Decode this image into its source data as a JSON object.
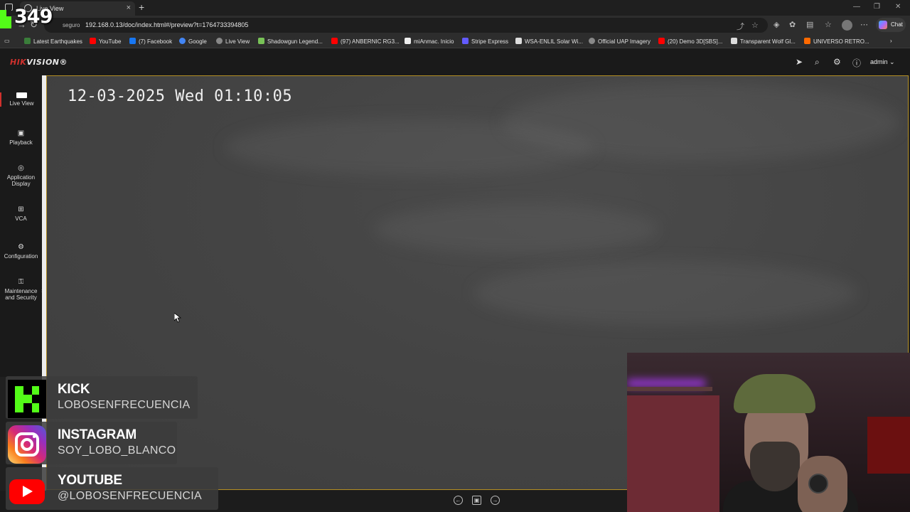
{
  "browser": {
    "tab_title": "Live View",
    "url_prefix": "seguro",
    "url": "192.168.0.13/doc/index.html#/preview?t=1764733394805",
    "chat_label": "Chat",
    "bookmarks": [
      {
        "label": "Latest Earthquakes",
        "color": "#3a7d3a"
      },
      {
        "label": "YouTube",
        "color": "#ff0000"
      },
      {
        "label": "(7) Facebook",
        "color": "#1877f2"
      },
      {
        "label": "Google",
        "color": "#4285f4"
      },
      {
        "label": "Live View",
        "color": "#888888"
      },
      {
        "label": "Shadowgun Legend...",
        "color": "#78c257"
      },
      {
        "label": "(97) ANBERNIC RG3...",
        "color": "#ff0000"
      },
      {
        "label": "miAnmac. Inicio",
        "color": "#222222"
      },
      {
        "label": "Stripe Express",
        "color": "#635bff"
      },
      {
        "label": "WSA-ENLIL Solar Wi...",
        "color": "#dddddd"
      },
      {
        "label": "Official UAP Imagery",
        "color": "#888888"
      },
      {
        "label": "(20) Demo 3D[SBS]...",
        "color": "#ff0000"
      },
      {
        "label": "Transparent Wolf Gl...",
        "color": "#dddddd"
      },
      {
        "label": "UNIVERSO RETRO...",
        "color": "#ff6a00"
      }
    ]
  },
  "kick_counter": "349",
  "hikvision": {
    "logo_hik": "HIK",
    "logo_rest": "VISION",
    "user": "admin",
    "sidebar": [
      {
        "label": "Live View"
      },
      {
        "label": "Playback"
      },
      {
        "label": "Application Display"
      },
      {
        "label": "VCA"
      },
      {
        "label": "Configuration"
      },
      {
        "label": "Maintenance and Security"
      }
    ],
    "osd_timestamp": "12-03-2025 Wed 01:10:05"
  },
  "socials": [
    {
      "name": "KICK",
      "handle": "LOBOSENFRECUENCIA"
    },
    {
      "name": "INSTAGRAM",
      "handle": "SOY_LOBO_BLANCO"
    },
    {
      "name": "YOUTUBE",
      "handle": "@LOBOSENFRECUENCIA"
    }
  ],
  "colors": {
    "hik_red": "#d0312d",
    "video_border": "#b38e23",
    "kick_green": "#53fc18"
  }
}
